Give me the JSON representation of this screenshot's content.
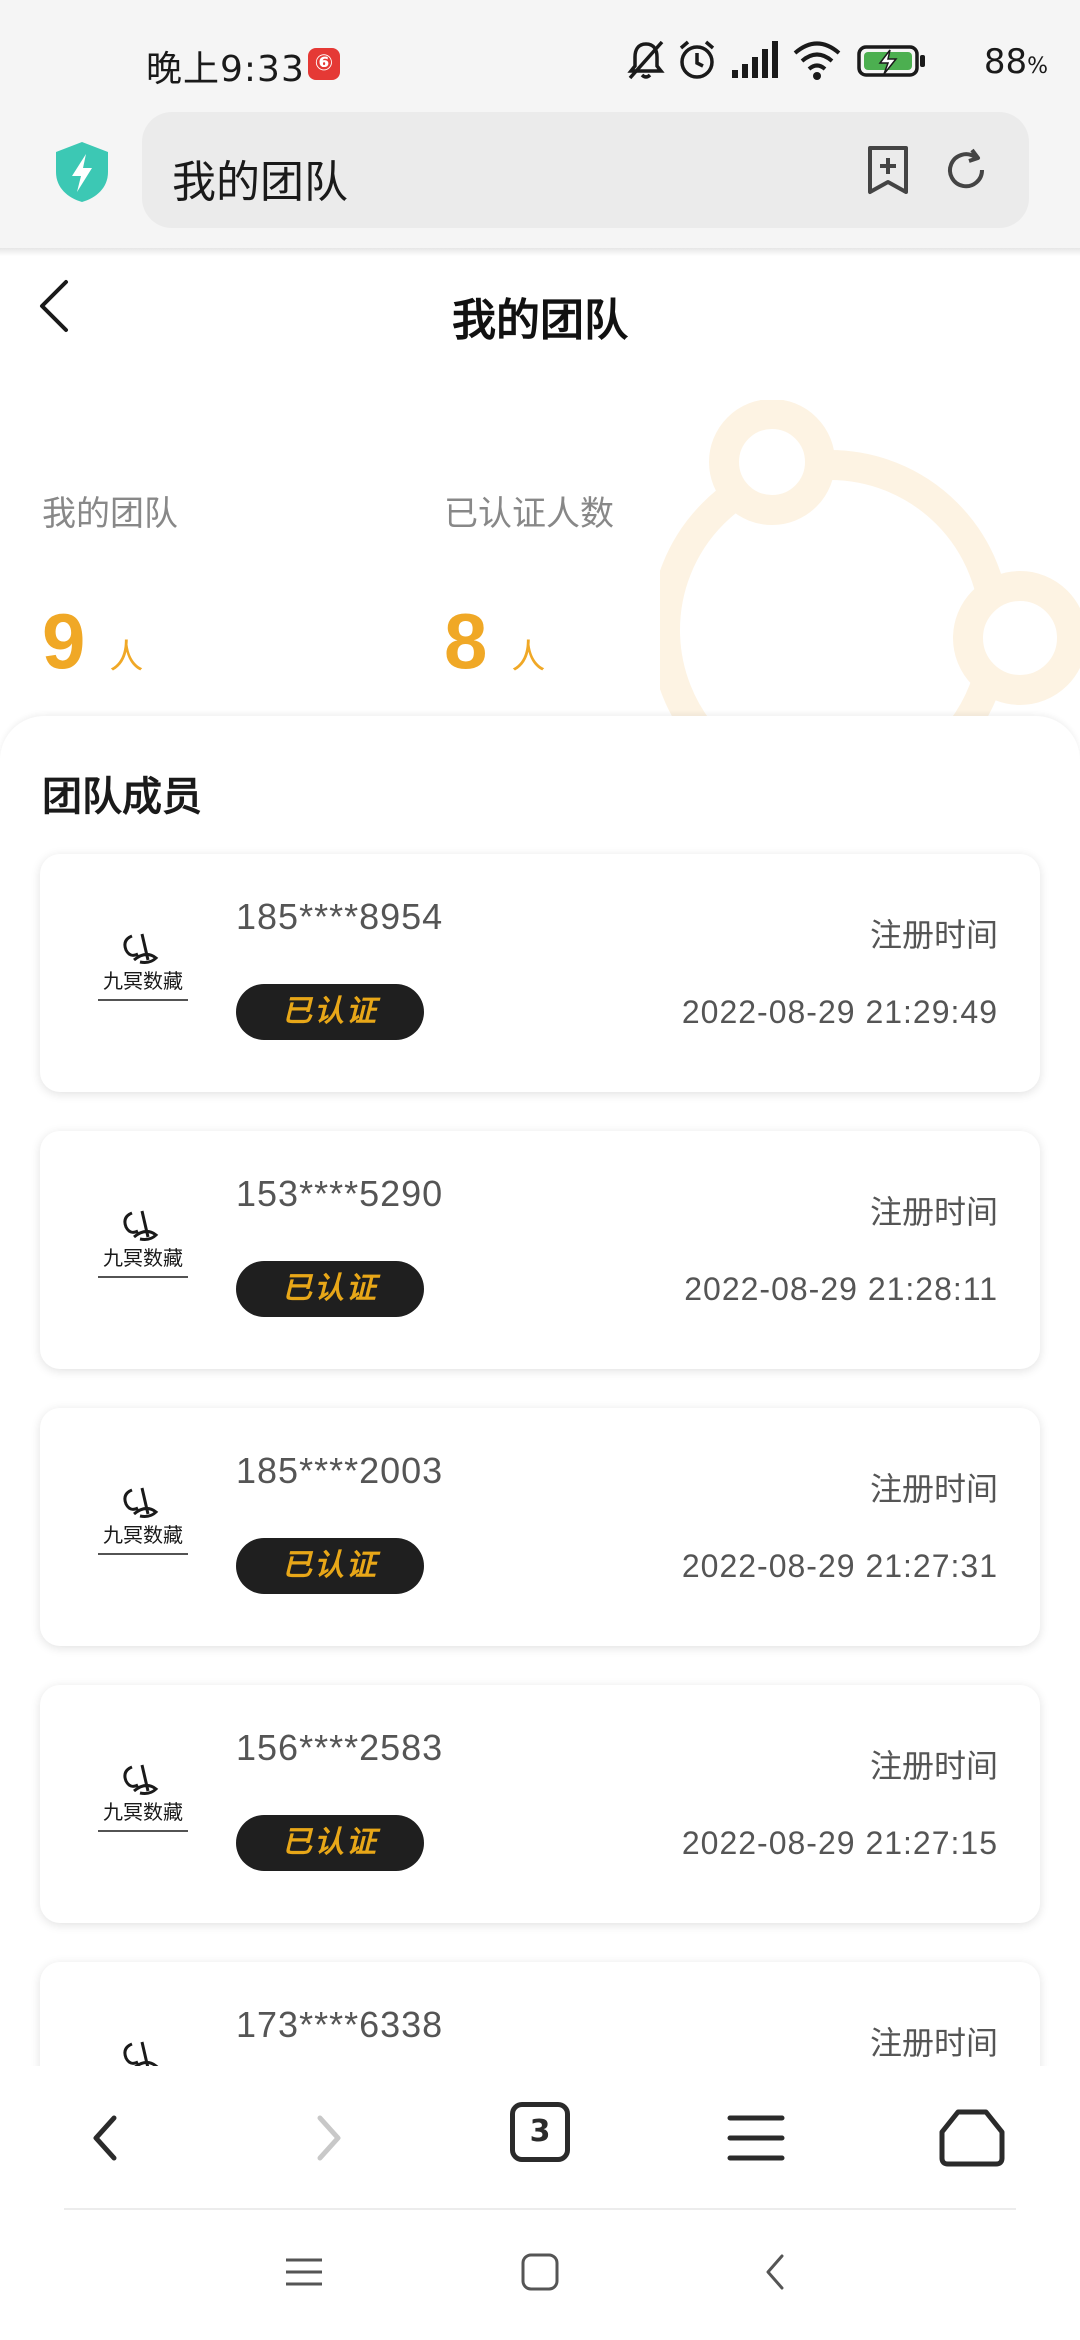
{
  "status_bar": {
    "time": "晚上9:33",
    "app_badge": "⑥",
    "battery": "88",
    "battery_unit": "%"
  },
  "browser": {
    "address": "我的团队",
    "tab_count": "3"
  },
  "page": {
    "title": "我的团队"
  },
  "stats": {
    "team_label": "我的团队",
    "team_count": "9",
    "team_unit": "人",
    "verified_label": "已认证人数",
    "verified_count": "8",
    "verified_unit": "人"
  },
  "members": {
    "section_title": "团队成员",
    "reg_label": "注册时间",
    "badge_label": "已认证",
    "logo_text": "九冥数藏",
    "items": [
      {
        "phone": "185****8954",
        "time": "2022-08-29 21:29:49"
      },
      {
        "phone": "153****5290",
        "time": "2022-08-29 21:28:11"
      },
      {
        "phone": "185****2003",
        "time": "2022-08-29 21:27:31"
      },
      {
        "phone": "156****2583",
        "time": "2022-08-29 21:27:15"
      },
      {
        "phone": "173****6338",
        "time": ""
      }
    ]
  },
  "colors": {
    "accent": "#f0a826",
    "badge_bg": "#1f1f1f",
    "shield": "#3cc8b4"
  }
}
